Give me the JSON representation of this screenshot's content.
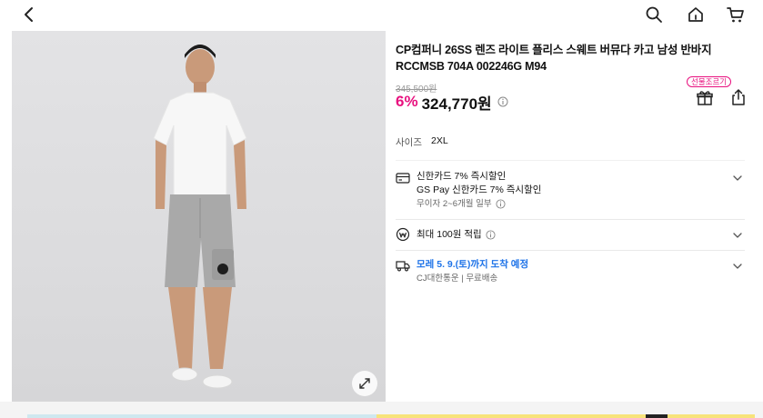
{
  "product": {
    "title": "CP컴퍼니 26SS 렌즈 라이트 플리스 스웨트 버뮤다 카고 남성 반바지 RCCMSB 704A 002246G M94",
    "original_price": "345,500원",
    "discount": "6%",
    "price": "324,770원",
    "gift_label": "선물조르기",
    "size_label": "사이즈",
    "size_value": "2XL"
  },
  "benefits": {
    "card_line1": "신한카드 7% 즉시할인",
    "card_line2": "GS Pay 신한카드 7% 즉시할인",
    "card_sub": "무이자 2~6개월 일부",
    "points": "최대 100원 적립",
    "delivery": "모레 5. 9.(토)까지 도착 예정",
    "delivery_sub": "CJ대한통운 | 무료배송"
  },
  "colors": {
    "discount": "#e8117f",
    "delivery_accent": "#1e73e8"
  },
  "icons": [
    "back-arrow-icon",
    "search-icon",
    "home-icon",
    "cart-icon",
    "expand-icon",
    "gift-icon",
    "share-icon",
    "card-icon",
    "coin-icon",
    "truck-icon",
    "chevron-down-icon",
    "info-icon"
  ]
}
